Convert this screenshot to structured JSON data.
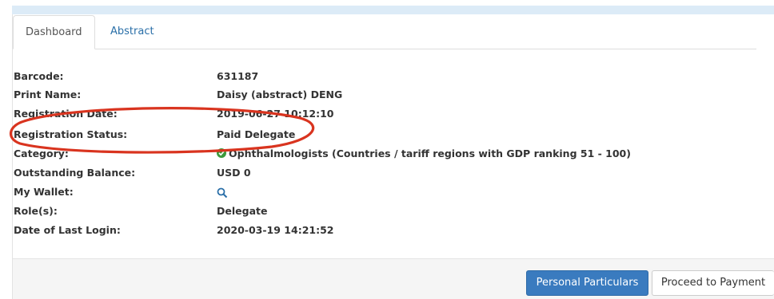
{
  "tabs": [
    {
      "label": "Dashboard",
      "active": true
    },
    {
      "label": "Abstract",
      "active": false
    }
  ],
  "details": [
    {
      "label": "Barcode:",
      "value": "631187"
    },
    {
      "label": "Print Name:",
      "value": "Daisy (abstract) DENG"
    },
    {
      "label": "Registration Date:",
      "value": "2019-06-27 10:12:10"
    },
    {
      "label": "Registration Status:",
      "value": "Paid Delegate"
    },
    {
      "label": "Category:",
      "value": "Ophthalmologists (Countries / tariff regions with GDP ranking 51 - 100)",
      "icon": "check-circle-icon"
    },
    {
      "label": "Outstanding Balance:",
      "value": "USD 0"
    },
    {
      "label": "My Wallet:",
      "icon": "search-icon"
    },
    {
      "label": "Role(s):",
      "value": "Delegate"
    },
    {
      "label": "Date of Last Login:",
      "value": "2020-03-19 14:21:52"
    }
  ],
  "footer": {
    "personal_particulars_label": "Personal Particulars",
    "proceed_payment_label": "Proceed to Payment"
  },
  "colors": {
    "accent": "#3a7bbf",
    "link": "#2a6fa8",
    "annotation": "#d9341f",
    "success": "#3c9a3c",
    "top_strip": "#dcebf7"
  }
}
